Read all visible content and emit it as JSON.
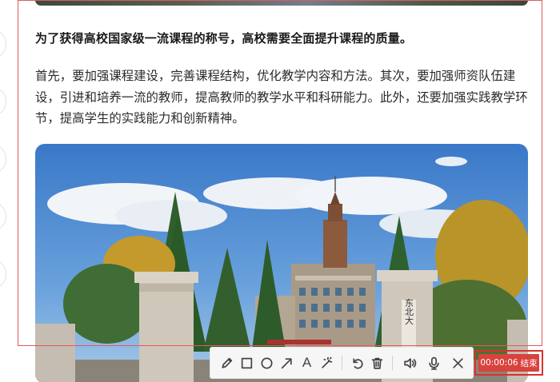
{
  "article": {
    "heading": "为了获得高校国家级一流课程的称号，高校需要全面提升课程的质量。",
    "paragraph": "首先，要加强课程建设，完善课程结构，优化教学内容和方法。其次，要加强师资队伍建设，引进和培养一流的教师，提高教师的教学水平和科研能力。此外，还要加强实践教学环节，提高学生的实践能力和创新精神。",
    "gate_sign": "东北大"
  },
  "toolbar": {
    "tools": [
      "pencil-icon",
      "rectangle-icon",
      "circle-icon",
      "arrow-icon",
      "text-icon",
      "magic-wand-icon",
      "undo-icon",
      "trash-icon",
      "speaker-icon",
      "microphone-icon",
      "close-icon"
    ],
    "text_tool_label": "A"
  },
  "recording": {
    "time": "00:00:06",
    "end_label": "结束",
    "color": "#d9423d"
  }
}
